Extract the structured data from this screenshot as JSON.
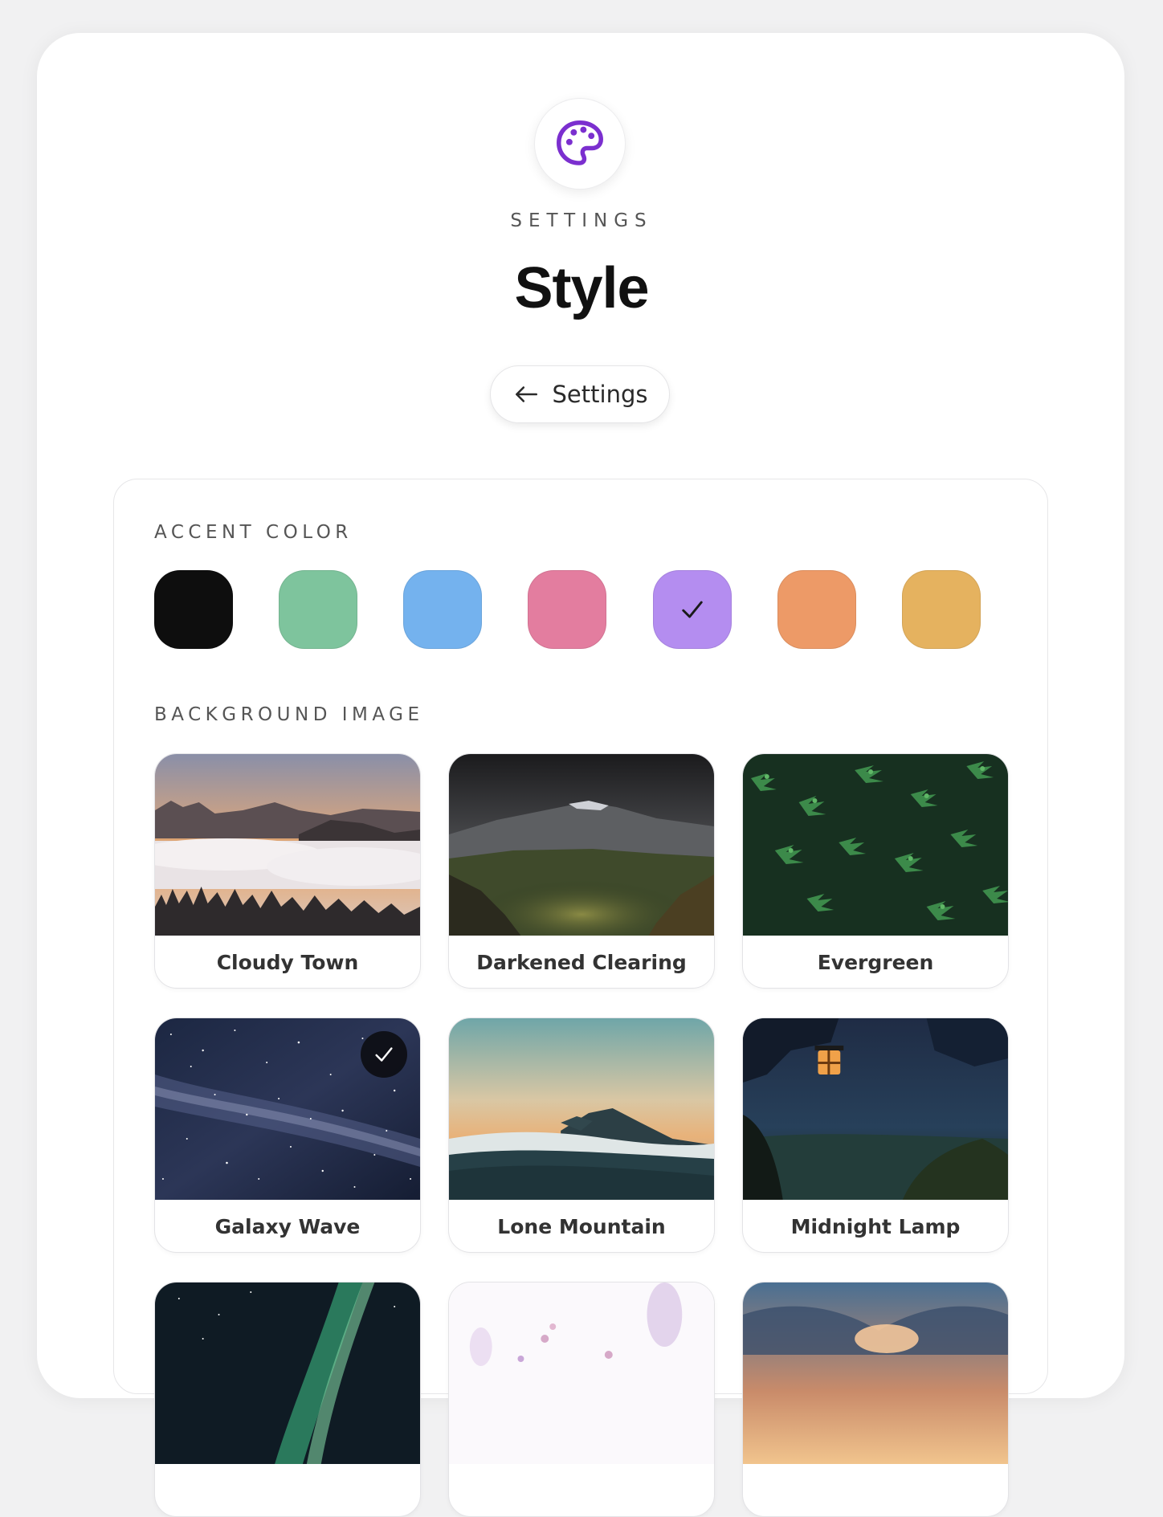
{
  "header": {
    "eyebrow": "SETTINGS",
    "title": "Style",
    "back_label": "Settings",
    "icon": "palette-icon"
  },
  "accent": {
    "label": "ACCENT COLOR",
    "selected": "purple",
    "swatches": [
      {
        "name": "black",
        "color": "#0e0e0e"
      },
      {
        "name": "green",
        "color": "#7ec49d"
      },
      {
        "name": "blue",
        "color": "#74b2ee"
      },
      {
        "name": "pink",
        "color": "#e37d9f"
      },
      {
        "name": "purple",
        "color": "#b48df0"
      },
      {
        "name": "orange",
        "color": "#ed9a67"
      },
      {
        "name": "yellow",
        "color": "#e5b25f"
      }
    ]
  },
  "background": {
    "label": "BACKGROUND IMAGE",
    "selected": "Galaxy Wave",
    "images": [
      {
        "title": "Cloudy Town"
      },
      {
        "title": "Darkened Clearing"
      },
      {
        "title": "Evergreen"
      },
      {
        "title": "Galaxy Wave"
      },
      {
        "title": "Lone Mountain"
      },
      {
        "title": "Midnight Lamp"
      },
      {
        "title": ""
      },
      {
        "title": ""
      },
      {
        "title": ""
      }
    ]
  },
  "colors": {
    "accent_purple": "#7b2fcf",
    "background": "#f1f1f2"
  }
}
